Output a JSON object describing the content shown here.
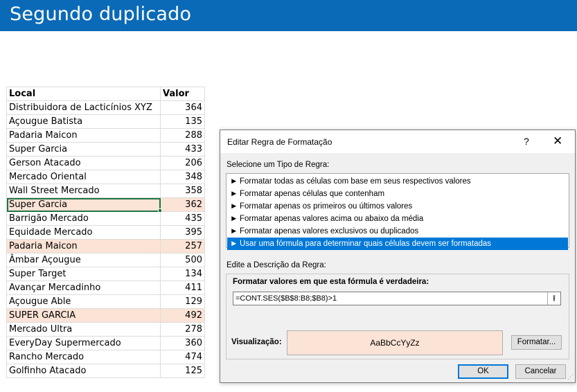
{
  "banner": {
    "title": "Segundo duplicado",
    "color": "#0a6ab7"
  },
  "sheet": {
    "headers": {
      "local": "Local",
      "valor": "Valor"
    },
    "rows": [
      {
        "local": "Distribuidora de Lacticínios XYZ",
        "valor": "364"
      },
      {
        "local": "Açougue Batista",
        "valor": "135"
      },
      {
        "local": "Padaria Maicon",
        "valor": "288"
      },
      {
        "local": "Super Garcia",
        "valor": "433"
      },
      {
        "local": "Gerson Atacado",
        "valor": "206"
      },
      {
        "local": "Mercado Oriental",
        "valor": "348"
      },
      {
        "local": "Wall Street Mercado",
        "valor": "358"
      },
      {
        "local": "Super Garcia",
        "valor": "362"
      },
      {
        "local": "Barrigão Mercado",
        "valor": "435"
      },
      {
        "local": "Equidade Mercado",
        "valor": "395"
      },
      {
        "local": "Padaria Maicon",
        "valor": "257"
      },
      {
        "local": "Âmbar Açougue",
        "valor": "500"
      },
      {
        "local": "Super Target",
        "valor": "134"
      },
      {
        "local": "Avançar Mercadinho",
        "valor": "411"
      },
      {
        "local": "Açougue Able",
        "valor": "129"
      },
      {
        "local": "SUPER GARCIA",
        "valor": "492"
      },
      {
        "local": "Mercado Ultra",
        "valor": "278"
      },
      {
        "local": "EveryDay Supermercado",
        "valor": "360"
      },
      {
        "local": "Rancho Mercado",
        "valor": "474"
      },
      {
        "local": "Golfinho Atacado",
        "valor": "125"
      }
    ],
    "highlight_color": "#fbe3d6",
    "selection_color": "#217346"
  },
  "dialog": {
    "title": "Editar Regra de Formatação",
    "help": "?",
    "close": "✕",
    "rule_type_label": "Selecione um Tipo de Regra:",
    "rule_types": [
      "Formatar todas as células com base em seus respectivos valores",
      "Formatar apenas células que contenham",
      "Formatar apenas os primeiros ou últimos valores",
      "Formatar apenas valores acima ou abaixo da média",
      "Formatar apenas valores exclusivos ou duplicados",
      "Usar uma fórmula para determinar quais células devem ser formatadas"
    ],
    "selected_rule_color": "#0078d7",
    "description_label": "Edite a Descrição da Regra:",
    "formula_label": "Formatar valores em que esta fórmula é verdadeira:",
    "formula_value": "=CONT.SES($B$8:B8;$B8)>1",
    "preview_label": "Visualização:",
    "preview_sample": "AaBbCcYyZz",
    "format_button": "Formatar...",
    "ok_button": "OK",
    "cancel_button": "Cancelar",
    "icons": {
      "arrow": "right-arrow-icon",
      "collapse": "collapse-dialog-icon"
    }
  }
}
